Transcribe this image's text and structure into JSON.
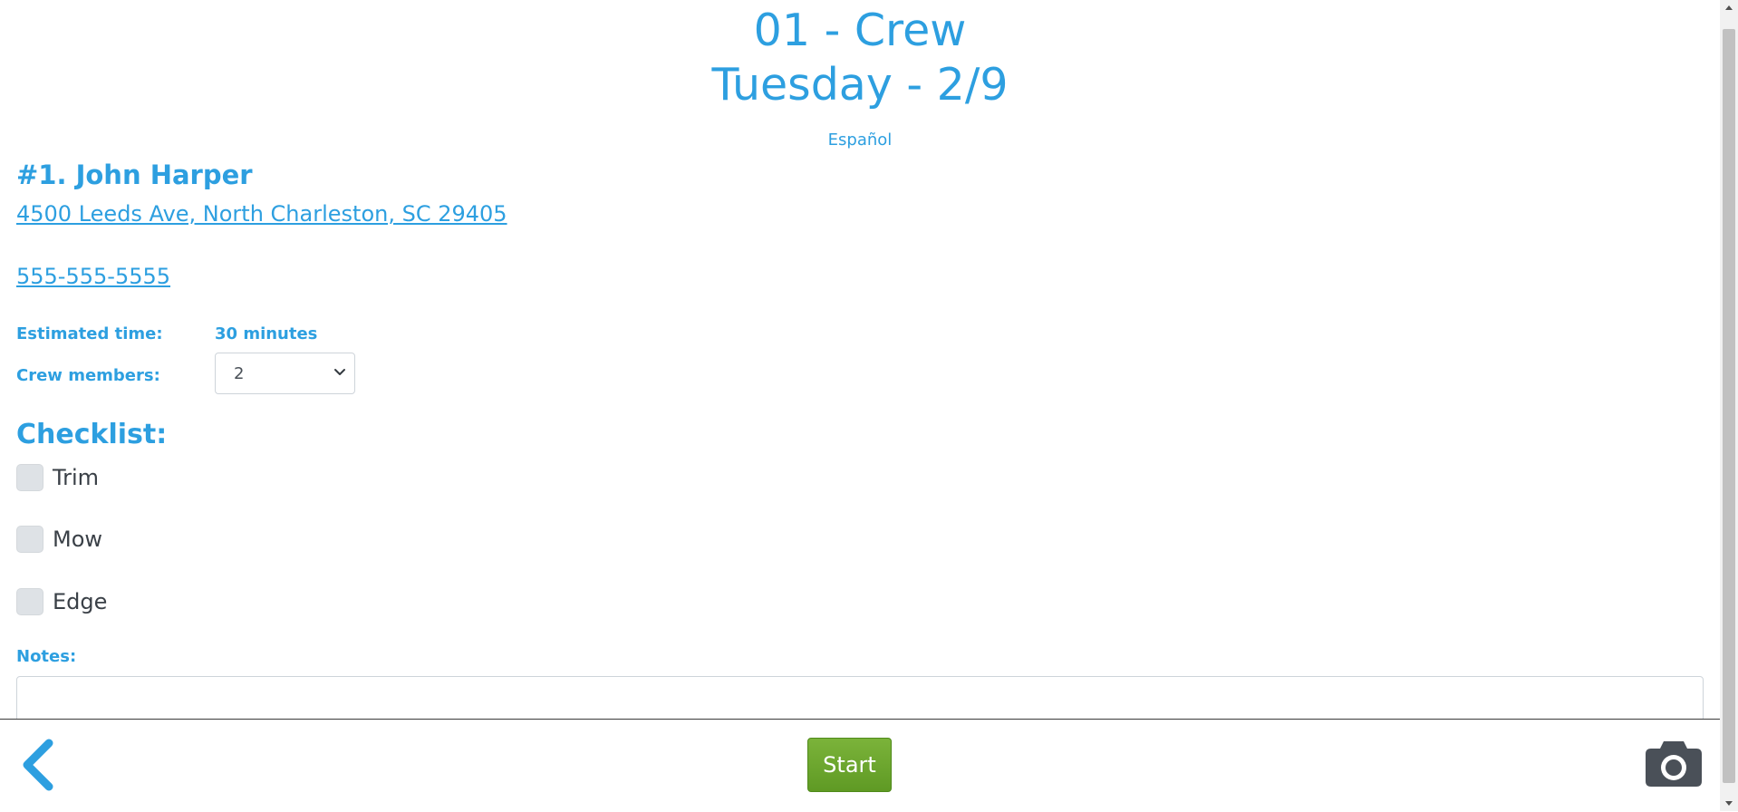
{
  "header": {
    "crew_title": "01 - Crew",
    "day_title": "Tuesday - 2/9",
    "language_link": "Español"
  },
  "client": {
    "name": "#1. John Harper",
    "address": "4500 Leeds Ave, North Charleston, SC 29405",
    "phone": "555-555-5555"
  },
  "fields": {
    "estimated_time_label": "Estimated time:",
    "estimated_time_value": "30 minutes",
    "crew_members_label": "Crew members:",
    "crew_members_value": "2"
  },
  "checklist": {
    "title": "Checklist:",
    "items": [
      {
        "label": "Trim",
        "checked": false
      },
      {
        "label": "Mow",
        "checked": false
      },
      {
        "label": "Edge",
        "checked": false
      }
    ]
  },
  "notes": {
    "label": "Notes:",
    "value": ""
  },
  "footer": {
    "start_label": "Start",
    "back_icon": "chevron-left-icon",
    "camera_icon": "camera-icon"
  },
  "colors": {
    "accent": "#2d9fe0",
    "start_button": "#6aa52e",
    "checkbox": "#dee2e6",
    "camera_icon": "#4a5058"
  }
}
